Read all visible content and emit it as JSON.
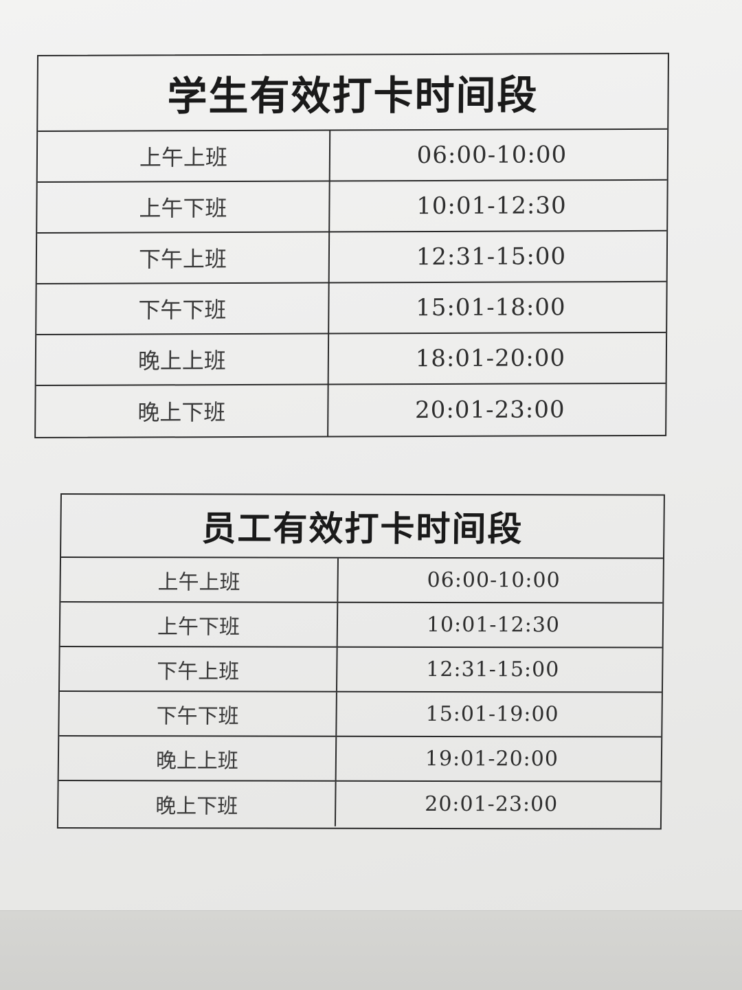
{
  "student_schedule": {
    "title": "学生有效打卡时间段",
    "rows": [
      {
        "label": "上午上班",
        "time": "06:00-10:00"
      },
      {
        "label": "上午下班",
        "time": "10:01-12:30"
      },
      {
        "label": "下午上班",
        "time": "12:31-15:00"
      },
      {
        "label": "下午下班",
        "time": "15:01-18:00"
      },
      {
        "label": "晚上上班",
        "time": "18:01-20:00"
      },
      {
        "label": "晚上下班",
        "time": "20:01-23:00"
      }
    ]
  },
  "staff_schedule": {
    "title": "员工有效打卡时间段",
    "rows": [
      {
        "label": "上午上班",
        "time": "06:00-10:00"
      },
      {
        "label": "上午下班",
        "time": "10:01-12:30"
      },
      {
        "label": "下午上班",
        "time": "12:31-15:00"
      },
      {
        "label": "下午下班",
        "time": "15:01-19:00"
      },
      {
        "label": "晚上上班",
        "time": "19:01-20:00"
      },
      {
        "label": "晚上下班",
        "time": "20:01-23:00"
      }
    ]
  }
}
